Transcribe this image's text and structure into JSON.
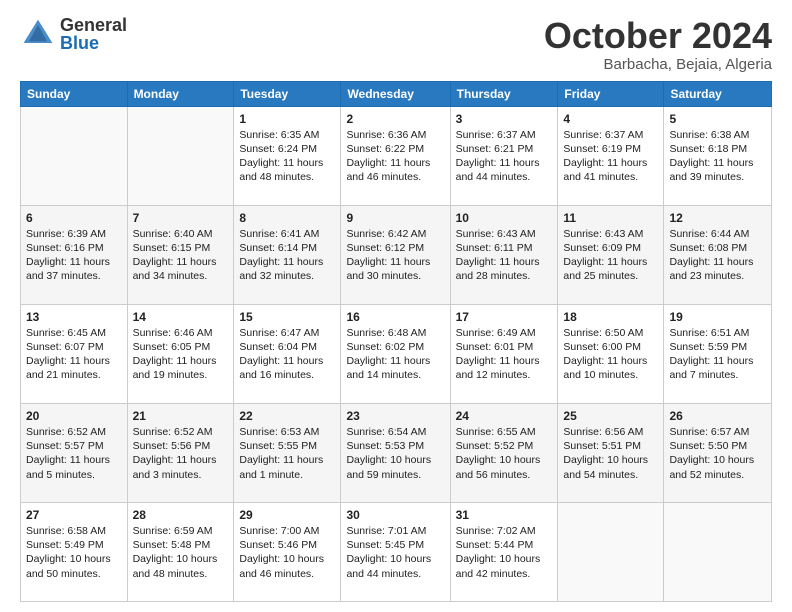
{
  "header": {
    "logo_general": "General",
    "logo_blue": "Blue",
    "month_title": "October 2024",
    "location": "Barbacha, Bejaia, Algeria"
  },
  "days_of_week": [
    "Sunday",
    "Monday",
    "Tuesday",
    "Wednesday",
    "Thursday",
    "Friday",
    "Saturday"
  ],
  "weeks": [
    [
      {
        "day": "",
        "sunrise": "",
        "sunset": "",
        "daylight": ""
      },
      {
        "day": "",
        "sunrise": "",
        "sunset": "",
        "daylight": ""
      },
      {
        "day": "1",
        "sunrise": "Sunrise: 6:35 AM",
        "sunset": "Sunset: 6:24 PM",
        "daylight": "Daylight: 11 hours and 48 minutes."
      },
      {
        "day": "2",
        "sunrise": "Sunrise: 6:36 AM",
        "sunset": "Sunset: 6:22 PM",
        "daylight": "Daylight: 11 hours and 46 minutes."
      },
      {
        "day": "3",
        "sunrise": "Sunrise: 6:37 AM",
        "sunset": "Sunset: 6:21 PM",
        "daylight": "Daylight: 11 hours and 44 minutes."
      },
      {
        "day": "4",
        "sunrise": "Sunrise: 6:37 AM",
        "sunset": "Sunset: 6:19 PM",
        "daylight": "Daylight: 11 hours and 41 minutes."
      },
      {
        "day": "5",
        "sunrise": "Sunrise: 6:38 AM",
        "sunset": "Sunset: 6:18 PM",
        "daylight": "Daylight: 11 hours and 39 minutes."
      }
    ],
    [
      {
        "day": "6",
        "sunrise": "Sunrise: 6:39 AM",
        "sunset": "Sunset: 6:16 PM",
        "daylight": "Daylight: 11 hours and 37 minutes."
      },
      {
        "day": "7",
        "sunrise": "Sunrise: 6:40 AM",
        "sunset": "Sunset: 6:15 PM",
        "daylight": "Daylight: 11 hours and 34 minutes."
      },
      {
        "day": "8",
        "sunrise": "Sunrise: 6:41 AM",
        "sunset": "Sunset: 6:14 PM",
        "daylight": "Daylight: 11 hours and 32 minutes."
      },
      {
        "day": "9",
        "sunrise": "Sunrise: 6:42 AM",
        "sunset": "Sunset: 6:12 PM",
        "daylight": "Daylight: 11 hours and 30 minutes."
      },
      {
        "day": "10",
        "sunrise": "Sunrise: 6:43 AM",
        "sunset": "Sunset: 6:11 PM",
        "daylight": "Daylight: 11 hours and 28 minutes."
      },
      {
        "day": "11",
        "sunrise": "Sunrise: 6:43 AM",
        "sunset": "Sunset: 6:09 PM",
        "daylight": "Daylight: 11 hours and 25 minutes."
      },
      {
        "day": "12",
        "sunrise": "Sunrise: 6:44 AM",
        "sunset": "Sunset: 6:08 PM",
        "daylight": "Daylight: 11 hours and 23 minutes."
      }
    ],
    [
      {
        "day": "13",
        "sunrise": "Sunrise: 6:45 AM",
        "sunset": "Sunset: 6:07 PM",
        "daylight": "Daylight: 11 hours and 21 minutes."
      },
      {
        "day": "14",
        "sunrise": "Sunrise: 6:46 AM",
        "sunset": "Sunset: 6:05 PM",
        "daylight": "Daylight: 11 hours and 19 minutes."
      },
      {
        "day": "15",
        "sunrise": "Sunrise: 6:47 AM",
        "sunset": "Sunset: 6:04 PM",
        "daylight": "Daylight: 11 hours and 16 minutes."
      },
      {
        "day": "16",
        "sunrise": "Sunrise: 6:48 AM",
        "sunset": "Sunset: 6:02 PM",
        "daylight": "Daylight: 11 hours and 14 minutes."
      },
      {
        "day": "17",
        "sunrise": "Sunrise: 6:49 AM",
        "sunset": "Sunset: 6:01 PM",
        "daylight": "Daylight: 11 hours and 12 minutes."
      },
      {
        "day": "18",
        "sunrise": "Sunrise: 6:50 AM",
        "sunset": "Sunset: 6:00 PM",
        "daylight": "Daylight: 11 hours and 10 minutes."
      },
      {
        "day": "19",
        "sunrise": "Sunrise: 6:51 AM",
        "sunset": "Sunset: 5:59 PM",
        "daylight": "Daylight: 11 hours and 7 minutes."
      }
    ],
    [
      {
        "day": "20",
        "sunrise": "Sunrise: 6:52 AM",
        "sunset": "Sunset: 5:57 PM",
        "daylight": "Daylight: 11 hours and 5 minutes."
      },
      {
        "day": "21",
        "sunrise": "Sunrise: 6:52 AM",
        "sunset": "Sunset: 5:56 PM",
        "daylight": "Daylight: 11 hours and 3 minutes."
      },
      {
        "day": "22",
        "sunrise": "Sunrise: 6:53 AM",
        "sunset": "Sunset: 5:55 PM",
        "daylight": "Daylight: 11 hours and 1 minute."
      },
      {
        "day": "23",
        "sunrise": "Sunrise: 6:54 AM",
        "sunset": "Sunset: 5:53 PM",
        "daylight": "Daylight: 10 hours and 59 minutes."
      },
      {
        "day": "24",
        "sunrise": "Sunrise: 6:55 AM",
        "sunset": "Sunset: 5:52 PM",
        "daylight": "Daylight: 10 hours and 56 minutes."
      },
      {
        "day": "25",
        "sunrise": "Sunrise: 6:56 AM",
        "sunset": "Sunset: 5:51 PM",
        "daylight": "Daylight: 10 hours and 54 minutes."
      },
      {
        "day": "26",
        "sunrise": "Sunrise: 6:57 AM",
        "sunset": "Sunset: 5:50 PM",
        "daylight": "Daylight: 10 hours and 52 minutes."
      }
    ],
    [
      {
        "day": "27",
        "sunrise": "Sunrise: 6:58 AM",
        "sunset": "Sunset: 5:49 PM",
        "daylight": "Daylight: 10 hours and 50 minutes."
      },
      {
        "day": "28",
        "sunrise": "Sunrise: 6:59 AM",
        "sunset": "Sunset: 5:48 PM",
        "daylight": "Daylight: 10 hours and 48 minutes."
      },
      {
        "day": "29",
        "sunrise": "Sunrise: 7:00 AM",
        "sunset": "Sunset: 5:46 PM",
        "daylight": "Daylight: 10 hours and 46 minutes."
      },
      {
        "day": "30",
        "sunrise": "Sunrise: 7:01 AM",
        "sunset": "Sunset: 5:45 PM",
        "daylight": "Daylight: 10 hours and 44 minutes."
      },
      {
        "day": "31",
        "sunrise": "Sunrise: 7:02 AM",
        "sunset": "Sunset: 5:44 PM",
        "daylight": "Daylight: 10 hours and 42 minutes."
      },
      {
        "day": "",
        "sunrise": "",
        "sunset": "",
        "daylight": ""
      },
      {
        "day": "",
        "sunrise": "",
        "sunset": "",
        "daylight": ""
      }
    ]
  ]
}
